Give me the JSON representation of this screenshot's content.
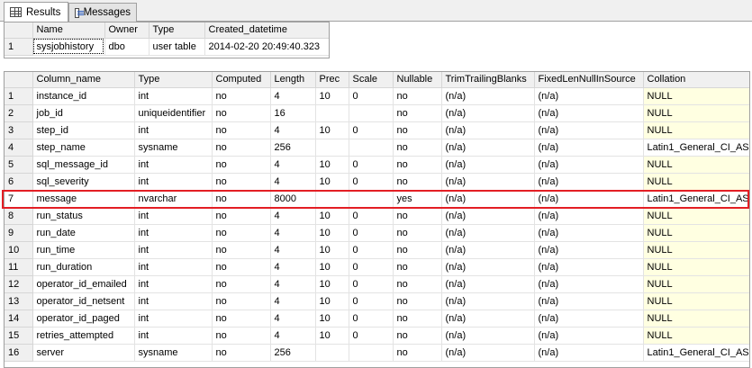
{
  "tabs": [
    {
      "label": "Results",
      "icon": "grid-icon",
      "active": true
    },
    {
      "label": "Messages",
      "icon": "messages-icon",
      "active": false
    }
  ],
  "table_info": {
    "columns": [
      "Name",
      "Owner",
      "Type",
      "Created_datetime"
    ],
    "rows": [
      {
        "num": "1",
        "cells": [
          "sysjobhistory",
          "dbo",
          "user table",
          "2014-02-20 20:49:40.323"
        ]
      }
    ]
  },
  "columns_grid": {
    "columns": [
      "Column_name",
      "Type",
      "Computed",
      "Length",
      "Prec",
      "Scale",
      "Nullable",
      "TrimTrailingBlanks",
      "FixedLenNullInSource",
      "Collation"
    ],
    "rows": [
      {
        "num": "1",
        "cells": [
          "instance_id",
          "int",
          "no",
          "4",
          "10",
          "0",
          "no",
          "(n/a)",
          "(n/a)",
          "NULL"
        ]
      },
      {
        "num": "2",
        "cells": [
          "job_id",
          "uniqueidentifier",
          "no",
          "16",
          "",
          "",
          "no",
          "(n/a)",
          "(n/a)",
          "NULL"
        ]
      },
      {
        "num": "3",
        "cells": [
          "step_id",
          "int",
          "no",
          "4",
          "10",
          "0",
          "no",
          "(n/a)",
          "(n/a)",
          "NULL"
        ]
      },
      {
        "num": "4",
        "cells": [
          "step_name",
          "sysname",
          "no",
          "256",
          "",
          "",
          "no",
          "(n/a)",
          "(n/a)",
          "Latin1_General_CI_AS"
        ]
      },
      {
        "num": "5",
        "cells": [
          "sql_message_id",
          "int",
          "no",
          "4",
          "10",
          "0",
          "no",
          "(n/a)",
          "(n/a)",
          "NULL"
        ]
      },
      {
        "num": "6",
        "cells": [
          "sql_severity",
          "int",
          "no",
          "4",
          "10",
          "0",
          "no",
          "(n/a)",
          "(n/a)",
          "NULL"
        ]
      },
      {
        "num": "7",
        "cells": [
          "message",
          "nvarchar",
          "no",
          "8000",
          "",
          "",
          "yes",
          "(n/a)",
          "(n/a)",
          "Latin1_General_CI_AS"
        ]
      },
      {
        "num": "8",
        "cells": [
          "run_status",
          "int",
          "no",
          "4",
          "10",
          "0",
          "no",
          "(n/a)",
          "(n/a)",
          "NULL"
        ]
      },
      {
        "num": "9",
        "cells": [
          "run_date",
          "int",
          "no",
          "4",
          "10",
          "0",
          "no",
          "(n/a)",
          "(n/a)",
          "NULL"
        ]
      },
      {
        "num": "10",
        "cells": [
          "run_time",
          "int",
          "no",
          "4",
          "10",
          "0",
          "no",
          "(n/a)",
          "(n/a)",
          "NULL"
        ]
      },
      {
        "num": "11",
        "cells": [
          "run_duration",
          "int",
          "no",
          "4",
          "10",
          "0",
          "no",
          "(n/a)",
          "(n/a)",
          "NULL"
        ]
      },
      {
        "num": "12",
        "cells": [
          "operator_id_emailed",
          "int",
          "no",
          "4",
          "10",
          "0",
          "no",
          "(n/a)",
          "(n/a)",
          "NULL"
        ]
      },
      {
        "num": "13",
        "cells": [
          "operator_id_netsent",
          "int",
          "no",
          "4",
          "10",
          "0",
          "no",
          "(n/a)",
          "(n/a)",
          "NULL"
        ]
      },
      {
        "num": "14",
        "cells": [
          "operator_id_paged",
          "int",
          "no",
          "4",
          "10",
          "0",
          "no",
          "(n/a)",
          "(n/a)",
          "NULL"
        ]
      },
      {
        "num": "15",
        "cells": [
          "retries_attempted",
          "int",
          "no",
          "4",
          "10",
          "0",
          "no",
          "(n/a)",
          "(n/a)",
          "NULL"
        ]
      },
      {
        "num": "16",
        "cells": [
          "server",
          "sysname",
          "no",
          "256",
          "",
          "",
          "no",
          "(n/a)",
          "(n/a)",
          "Latin1_General_CI_AS"
        ]
      }
    ],
    "highlighted_row": "7"
  },
  "colors": {
    "highlight_border": "#e31e24",
    "null_cell_bg": "#ffffe1",
    "header_bg": "#f0f0f0"
  }
}
